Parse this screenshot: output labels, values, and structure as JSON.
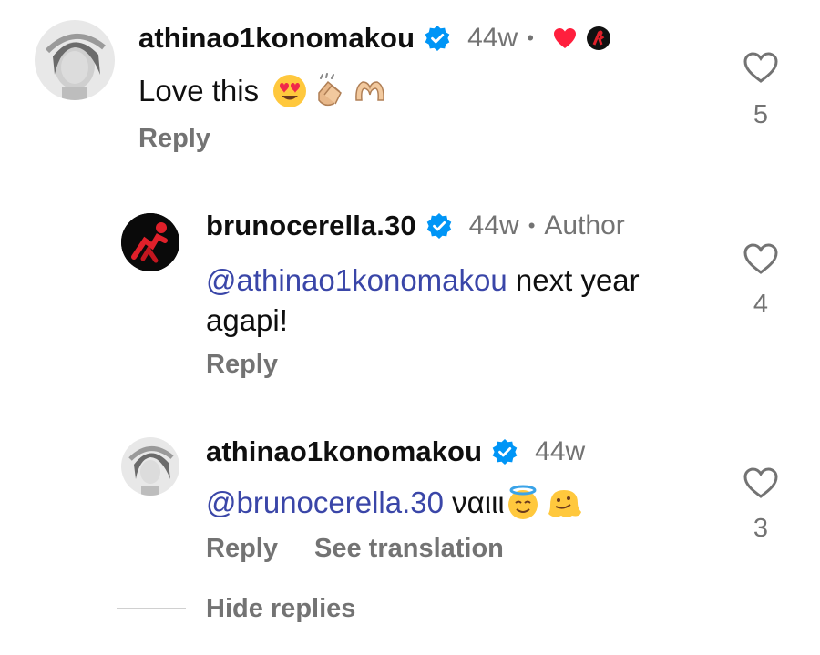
{
  "comments": [
    {
      "username": "athinao1konomakou",
      "verified": true,
      "time": "44w",
      "author_badge": "",
      "text": "Love this",
      "emojis": [
        "heart-eyes-emoji",
        "clapping-hands-emoji",
        "heart-hands-emoji"
      ],
      "mention": "",
      "reply_label": "Reply",
      "likes": "5",
      "avatar": "woman-portrait"
    },
    {
      "username": "brunocerella.30",
      "verified": true,
      "time": "44w",
      "author_badge": "Author",
      "mention": "@athinao1konomakou",
      "text": " next year",
      "text_line2": "agapi!",
      "reply_label": "Reply",
      "likes": "4",
      "avatar": "player-red"
    },
    {
      "username": "athinao1konomakou",
      "verified": true,
      "time": "44w",
      "mention": "@brunocerella.30",
      "text": " ναιιι",
      "emojis": [
        "halo-face-emoji",
        "melting-face-emoji"
      ],
      "reply_label": "Reply",
      "translate_label": "See translation",
      "likes": "3",
      "avatar": "woman-portrait"
    }
  ],
  "hide_replies_label": "Hide replies",
  "separator_dot": "•",
  "colors": {
    "verified": "#0095f6",
    "mention": "#3a46a8",
    "muted": "#737373"
  }
}
